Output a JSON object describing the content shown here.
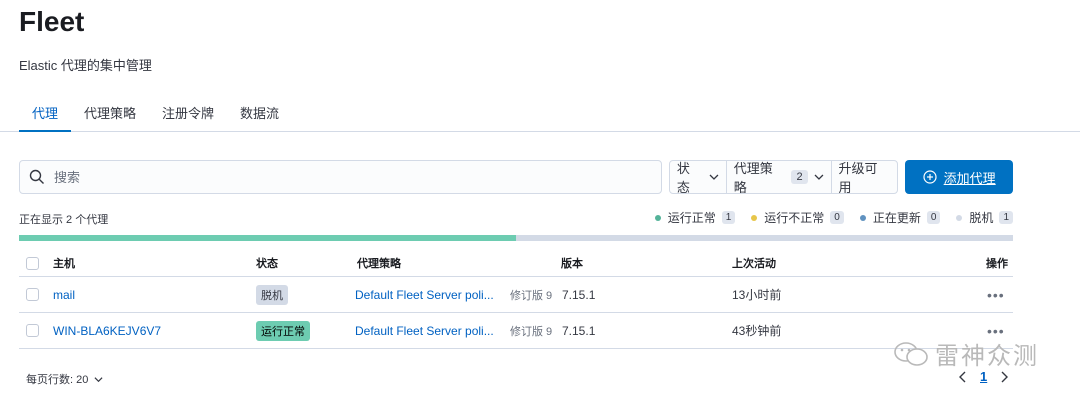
{
  "header": {
    "title": "Fleet",
    "subtitle": "Elastic 代理的集中管理",
    "tabs": [
      {
        "label": "代理",
        "active": true
      },
      {
        "label": "代理策略",
        "active": false
      },
      {
        "label": "注册令牌",
        "active": false
      },
      {
        "label": "数据流",
        "active": false
      }
    ]
  },
  "toolbar": {
    "search_placeholder": "搜索",
    "filters": {
      "status_label": "状态",
      "policy_label": "代理策略",
      "policy_count": "2",
      "upgrade_label": "升级可用"
    },
    "add_button_label": "添加代理"
  },
  "summary": {
    "showing_text": "正在显示 2 个代理",
    "legend": [
      {
        "label": "运行正常",
        "count": "1",
        "color": "#54b399"
      },
      {
        "label": "运行不正常",
        "count": "0",
        "color": "#e7c64a"
      },
      {
        "label": "正在更新",
        "count": "0",
        "color": "#6092c0"
      },
      {
        "label": "脱机",
        "count": "1",
        "color": "#d3dae6"
      }
    ],
    "health_bar": [
      {
        "status": "运行正常",
        "fraction": 0.5,
        "color": "#6dccb1"
      },
      {
        "status": "脱机",
        "fraction": 0.5,
        "color": "#d3dae6"
      }
    ]
  },
  "table": {
    "columns": {
      "host": "主机",
      "status": "状态",
      "policy": "代理策略",
      "version": "版本",
      "last_activity": "上次活动",
      "actions": "操作"
    },
    "rows": [
      {
        "host": "mail",
        "status": "脱机",
        "status_bg": "#d3dae6",
        "status_fg": "#343741",
        "policy": "Default Fleet Server poli...",
        "revision": "修订版 9",
        "version": "7.15.1",
        "last_activity": "13小时前",
        "actions": "•••"
      },
      {
        "host": "WIN-BLA6KEJV6V7",
        "status": "运行正常",
        "status_bg": "#6dccb1",
        "status_fg": "#000000",
        "policy": "Default Fleet Server poli...",
        "revision": "修订版 9",
        "version": "7.15.1",
        "last_activity": "43秒钟前",
        "actions": "•••"
      }
    ]
  },
  "footer": {
    "rows_per_page": "每页行数: 20",
    "current_page": "1"
  },
  "watermark": {
    "text": "雷神众测"
  }
}
